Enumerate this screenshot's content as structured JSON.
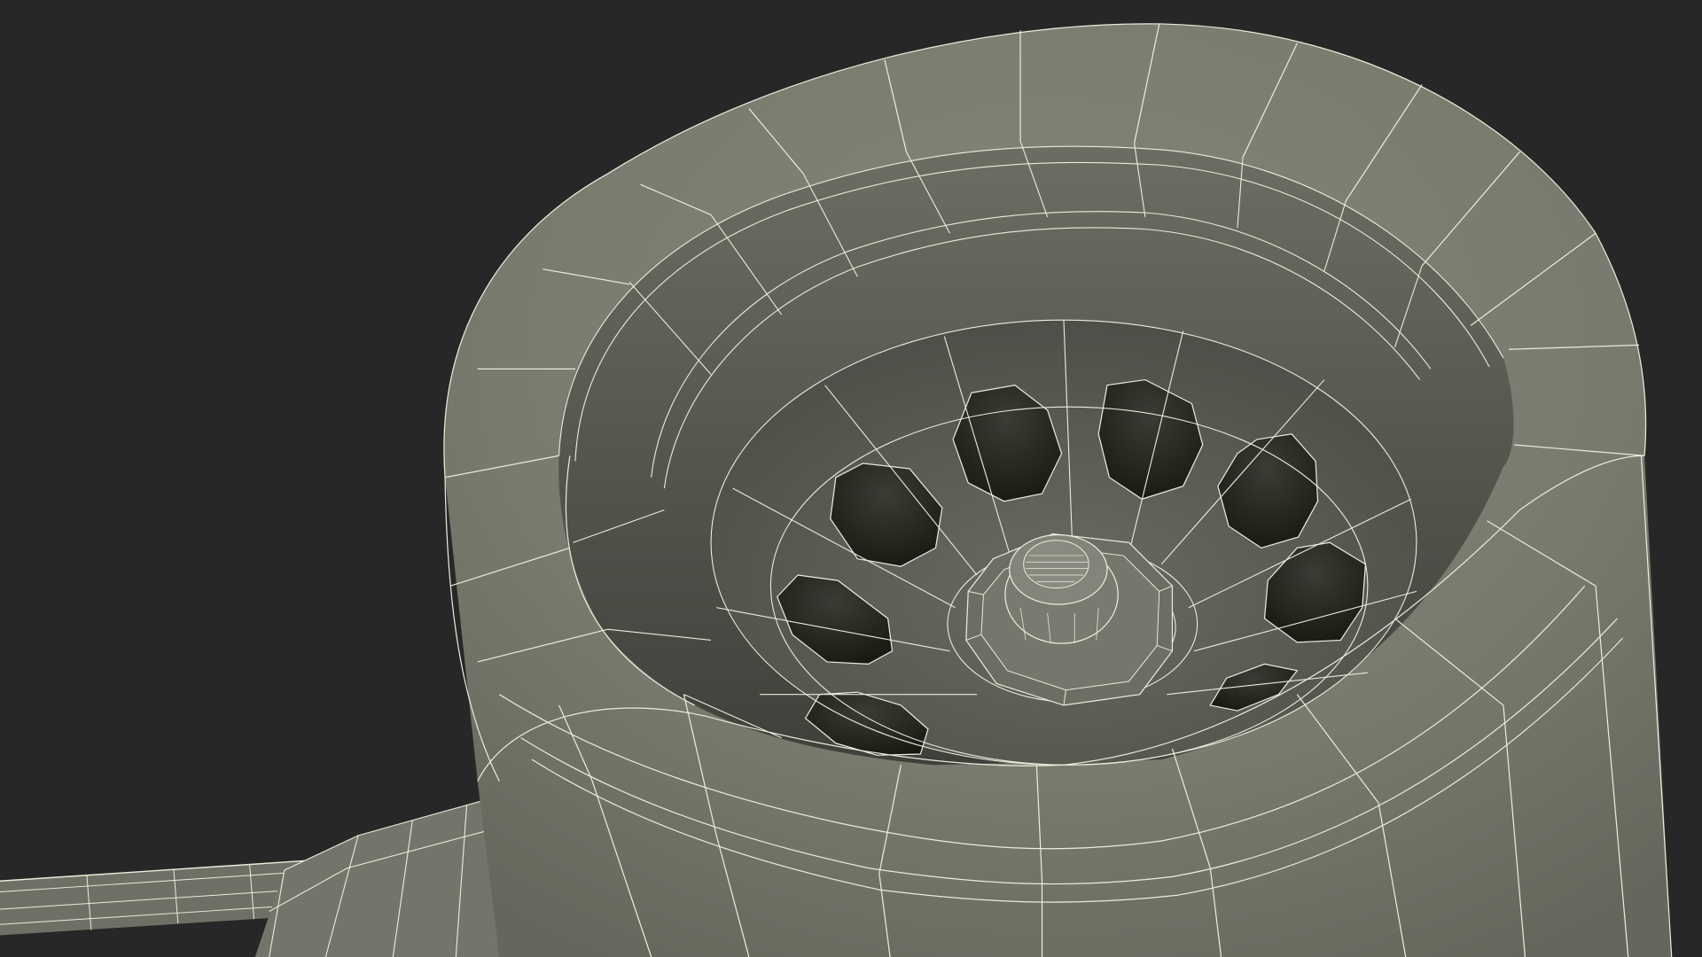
{
  "scene": {
    "subject": "wireframe-render",
    "colors": {
      "background": "#272727",
      "surface": "#7b7b6f",
      "surface_shadow": "#55564e",
      "inner_wall": "#5f6058",
      "hole": "#1b1d18",
      "wire": "#ececdc"
    }
  }
}
